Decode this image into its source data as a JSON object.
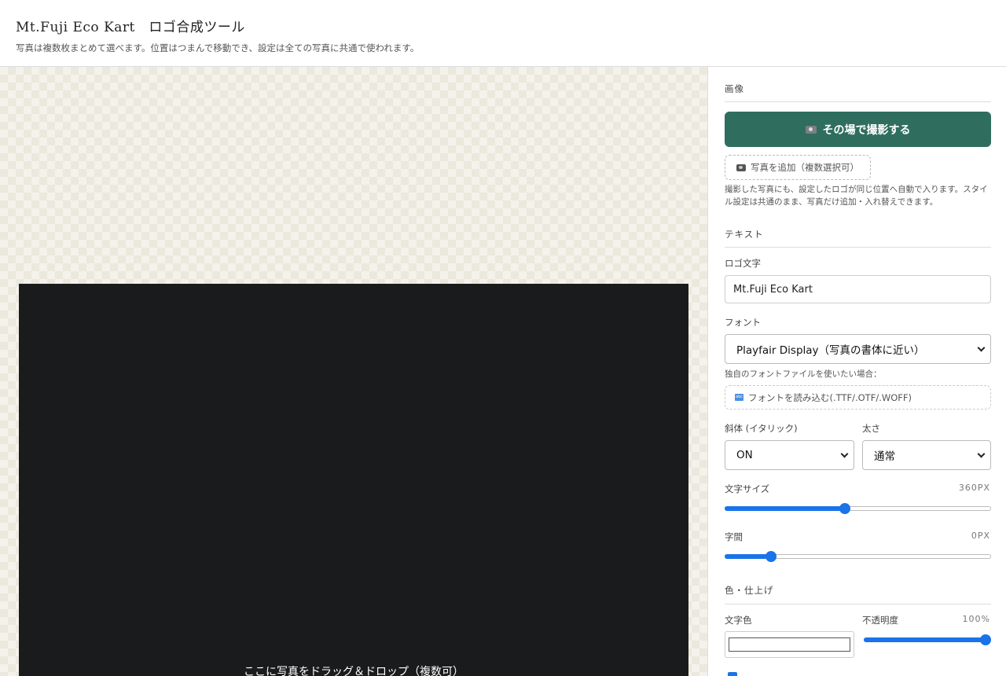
{
  "header": {
    "title": "Mt.Fuji Eco Kart　ロゴ合成ツール",
    "subtitle": "写真は複数枚まとめて選べます。位置はつまんで移動でき、設定は全ての写真に共通で使われます。"
  },
  "canvas": {
    "drop_hint": "ここに写真をドラッグ＆ドロップ（複数可）"
  },
  "panel": {
    "image_section": {
      "title": "画像",
      "capture_label": "その場で撮影する",
      "add_label": "写真を追加（複数選択可）",
      "note": "撮影した写真にも、設定したロゴが同じ位置へ自動で入ります。スタイル設定は共通のまま、写真だけ追加・入れ替えできます。"
    },
    "text_section": {
      "title": "テキスト",
      "logo_label": "ロゴ文字",
      "logo_value": "Mt.Fuji Eco Kart",
      "font_label": "フォント",
      "font_selected": "Playfair Display（写真の書体に近い）",
      "custom_font_note": "独自のフォントファイルを使いたい場合：",
      "font_file_label": "フォントを読み込む(.TTF/.OTF/.WOFF)",
      "italic_label": "斜体 (イタリック)",
      "italic_selected": "ON",
      "weight_label": "太さ",
      "weight_selected": "通常",
      "size_label": "文字サイズ",
      "size_value": "360PX",
      "size_fraction": 0.45,
      "spacing_label": "字間",
      "spacing_value": "0PX",
      "spacing_fraction": 0.16
    },
    "color_section": {
      "title": "色・仕上げ",
      "color_label": "文字色",
      "color_value": "#ffffff",
      "opacity_label": "不透明度",
      "opacity_value": "100%",
      "opacity_fraction": 1.0
    }
  },
  "colors": {
    "accent": "#2f6e5f",
    "slider": "#1a73e8",
    "preview_bg": "#1a1b1d"
  }
}
